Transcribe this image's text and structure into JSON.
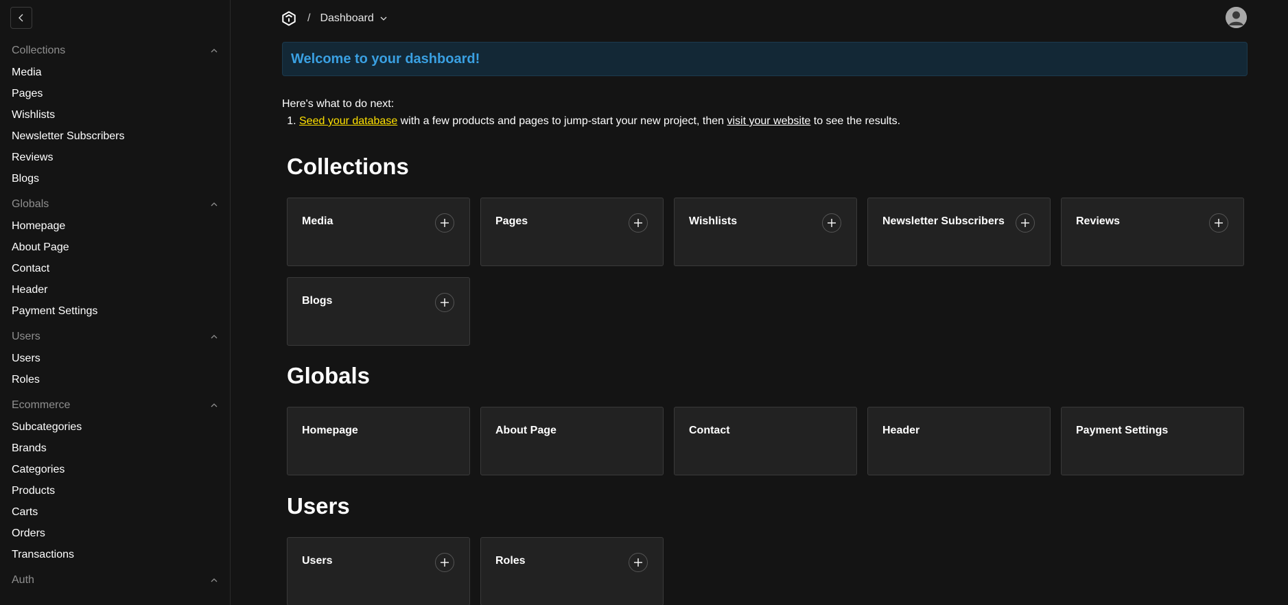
{
  "sidebar": {
    "groups": [
      {
        "title": "Collections",
        "items": [
          "Media",
          "Pages",
          "Wishlists",
          "Newsletter Subscribers",
          "Reviews",
          "Blogs"
        ]
      },
      {
        "title": "Globals",
        "items": [
          "Homepage",
          "About Page",
          "Contact",
          "Header",
          "Payment Settings"
        ]
      },
      {
        "title": "Users",
        "items": [
          "Users",
          "Roles"
        ]
      },
      {
        "title": "Ecommerce",
        "items": [
          "Subcategories",
          "Brands",
          "Categories",
          "Products",
          "Carts",
          "Orders",
          "Transactions"
        ]
      },
      {
        "title": "Auth",
        "items": []
      }
    ]
  },
  "topbar": {
    "separator": "/",
    "current": "Dashboard"
  },
  "welcome": "Welcome to your dashboard!",
  "next_steps": {
    "intro": "Here's what to do next:",
    "seed_link": "Seed your database",
    "middle_text": " with a few products and pages to jump-start your new project, then ",
    "visit_link": "visit your website",
    "end_text": " to see the results."
  },
  "sections": {
    "collections": {
      "title": "Collections",
      "cards": [
        "Media",
        "Pages",
        "Wishlists",
        "Newsletter Subscribers",
        "Reviews",
        "Blogs"
      ]
    },
    "globals": {
      "title": "Globals",
      "cards": [
        "Homepage",
        "About Page",
        "Contact",
        "Header",
        "Payment Settings"
      ]
    },
    "users": {
      "title": "Users",
      "cards": [
        "Users",
        "Roles"
      ]
    }
  }
}
